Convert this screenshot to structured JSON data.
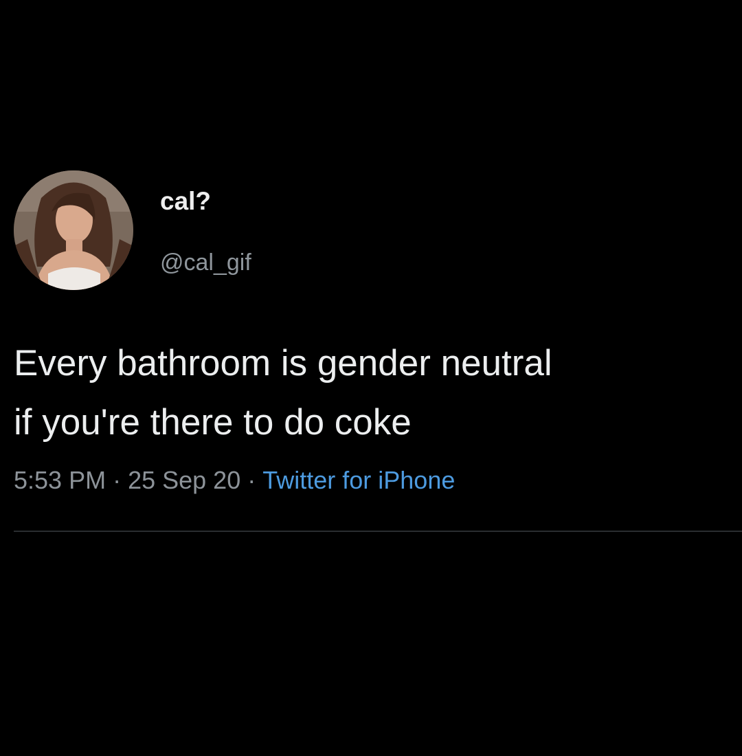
{
  "tweet": {
    "display_name": "cal?",
    "handle": "@cal_gif",
    "text": "Every bathroom is gender neutral\nif you're there to do coke",
    "time": "5:53 PM",
    "date": "25 Sep 20",
    "separator": "·",
    "source": "Twitter for iPhone"
  },
  "colors": {
    "background": "#000000",
    "text": "#eceeef",
    "muted": "#8d9399",
    "link": "#4d9be0",
    "divider": "#2a2d30"
  },
  "icons": {
    "avatar": "profile-photo"
  }
}
